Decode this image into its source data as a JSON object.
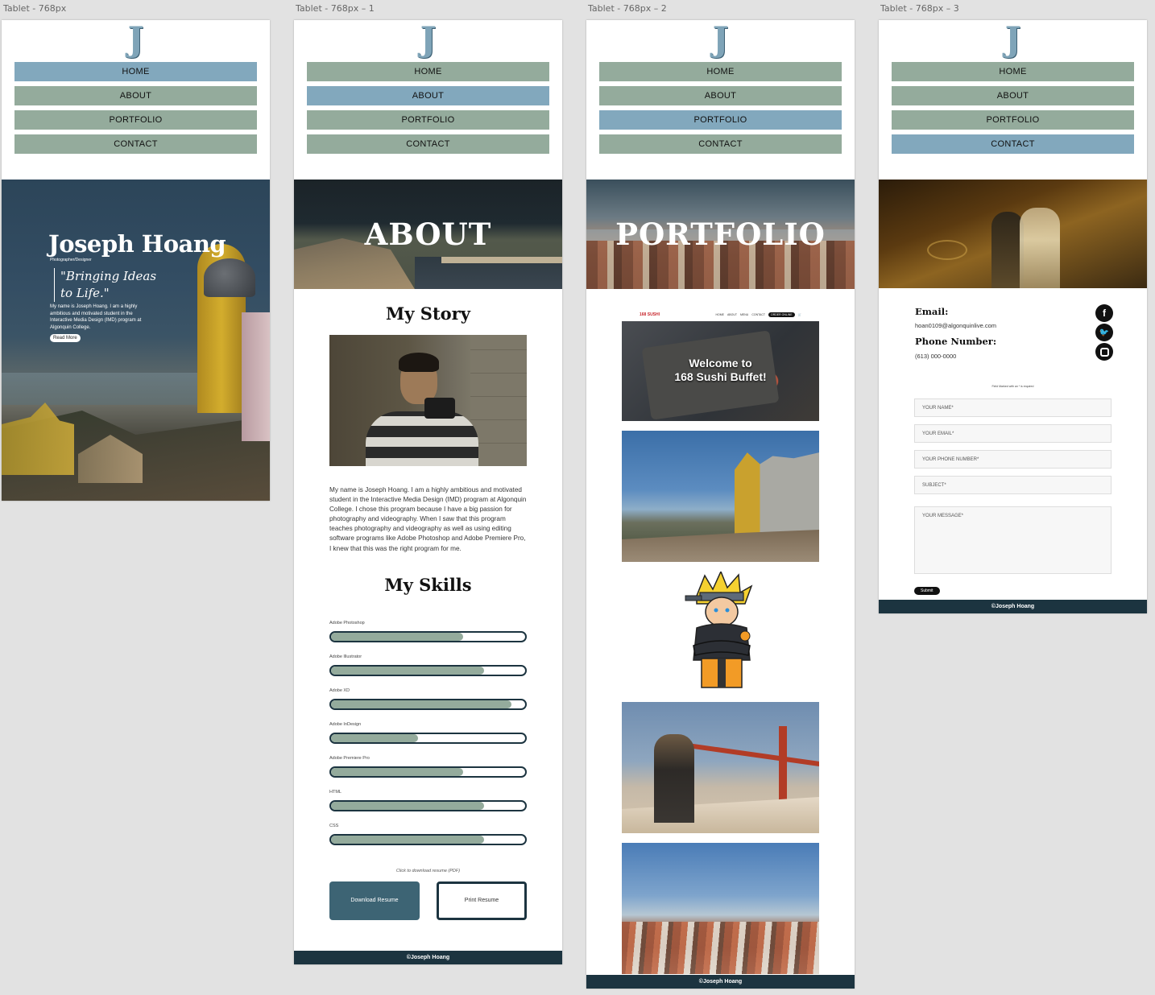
{
  "artboards": {
    "home": {
      "title": "Tablet - 768px"
    },
    "about": {
      "title": "Tablet - 768px – 1"
    },
    "portfolio": {
      "title": "Tablet - 768px – 2"
    },
    "contact": {
      "title": "Tablet - 768px – 3"
    }
  },
  "logo": "J",
  "nav": {
    "home": "HOME",
    "about": "ABOUT",
    "portfolio": "PORTFOLIO",
    "contact": "CONTACT"
  },
  "footer": "©Joseph Hoang",
  "home": {
    "name": "Joseph Hoang",
    "role": "Photographer/Designer",
    "quote": "\"Bringing Ideas to Life.\"",
    "intro": "My name is Joseph Hoang. I am a highly ambitious and motivated student in the Interactive Media Design (IMD) program at Algonquin College.",
    "read_more": "Read More"
  },
  "about": {
    "banner": "ABOUT",
    "story_title": "My Story",
    "story_text": "My name is Joseph Hoang. I am a highly ambitious and motivated student in the Interactive Media Design (IMD) program at Algonquin College. I chose this program because I have a big passion for photography and videography. When I saw that this program teaches photography and videography as well as using editing software programs like Adobe Photoshop and Adobe Premiere Pro, I knew that this was the right program for me.",
    "skills_title": "My Skills",
    "skills": [
      {
        "name": "Adobe Photoshop",
        "level": 0.68
      },
      {
        "name": "Adobe Illustrator",
        "level": 0.79
      },
      {
        "name": "Adobe XD",
        "level": 0.93
      },
      {
        "name": "Adobe InDesign",
        "level": 0.45
      },
      {
        "name": "Adobe Premiere Pro",
        "level": 0.68
      },
      {
        "name": "HTML",
        "level": 0.79
      },
      {
        "name": "CSS",
        "level": 0.79
      }
    ],
    "download_note": "Click to download resume (PDF)",
    "download_btn": "Download Resume",
    "print_btn": "Print Resume"
  },
  "portfolio": {
    "banner": "PORTFOLIO",
    "sushi": {
      "logo": "168 SUSHI",
      "links": [
        "HOME",
        "ABOUT",
        "MENU",
        "CONTACT"
      ],
      "order": "ORDER ONLINE",
      "headline_1": "Welcome to",
      "headline_2": "168 Sushi Buffet!"
    }
  },
  "contact": {
    "email_label": "Email:",
    "email": "hoan0109@algonquinlive.com",
    "phone_label": "Phone Number:",
    "phone": "(613) 000-0000",
    "required_note": "Field Marked with an * is required",
    "placeholders": [
      "YOUR NAME*",
      "YOUR EMAIL*",
      "YOUR PHONE NUMBER*",
      "SUBJECT*"
    ],
    "message_placeholder": "YOUR MESSAGE*",
    "submit": "Submit",
    "social": [
      "facebook-icon",
      "twitter-icon",
      "instagram-icon"
    ]
  }
}
